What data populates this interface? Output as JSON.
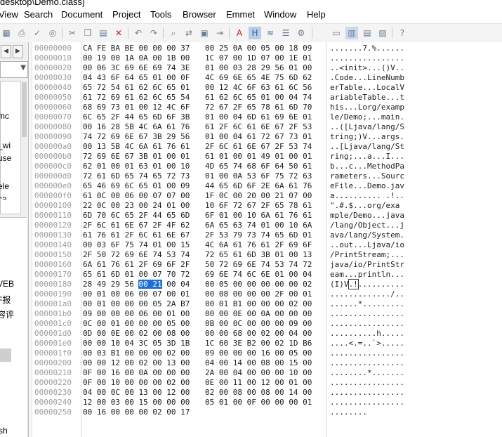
{
  "window": {
    "title_fragment": "desktop\\Demo.class]"
  },
  "menubar": {
    "items": [
      "View",
      "Search",
      "Document",
      "Project",
      "Tools",
      "Browser",
      "Emmet",
      "Window",
      "Help"
    ]
  },
  "toolbar": {
    "icons": [
      "grid-icon",
      "print-icon",
      "spellcheck-icon",
      "web-preview-icon",
      "cut-icon",
      "copy-icon",
      "paste-icon",
      "delete-icon",
      "undo-icon",
      "redo-icon",
      "find-icon",
      "replace-icon",
      "find-in-files-icon",
      "goto-icon",
      "font-icon",
      "hex-mode-icon",
      "word-wrap-icon",
      "line-numbers-icon",
      "settings-gear-icon",
      "layout-1-icon",
      "layout-2-icon",
      "layout-3-icon",
      "layout-4-icon",
      "help-icon"
    ]
  },
  "sidebar": {
    "nav_left": "◀",
    "nav_right": "▶",
    "combo_arrow": "▼",
    "list_fragments": [
      "mc",
      "_wi",
      "use",
      "ele",
      "ca"
    ],
    "panel_fragments": [
      "VEB",
      "F报",
      "容评",
      "sh"
    ]
  },
  "hex": {
    "rows": [
      {
        "addr": "00000000",
        "a": "CA FE BA BE 00 00 00 37",
        "b": "00 25 0A 00 05 00 18 09",
        "ascii": ".......7.%......"
      },
      {
        "addr": "00000010",
        "a": "00 19 00 1A 0A 00 1B 00",
        "b": "1C 07 00 1D 07 00 1E 01",
        "ascii": "................"
      },
      {
        "addr": "00000020",
        "a": "00 06 3C 69 6E 69 74 3E",
        "b": "01 00 03 28 29 56 01 00",
        "ascii": "..<init>...()V.."
      },
      {
        "addr": "00000030",
        "a": "04 43 6F 64 65 01 00 0F",
        "b": "4C 69 6E 65 4E 75 6D 62",
        "ascii": ".Code...LineNumb"
      },
      {
        "addr": "00000040",
        "a": "65 72 54 61 62 6C 65 01",
        "b": "00 12 4C 6F 63 61 6C 56",
        "ascii": "erTable...LocalV"
      },
      {
        "addr": "00000050",
        "a": "61 72 69 61 62 6C 65 54",
        "b": "61 62 6C 65 01 00 04 74",
        "ascii": "ariableTable...t"
      },
      {
        "addr": "00000060",
        "a": "68 69 73 01 00 12 4C 6F",
        "b": "72 67 2F 65 78 61 6D 70",
        "ascii": "his...Lorg/examp"
      },
      {
        "addr": "00000070",
        "a": "6C 65 2F 44 65 6D 6F 3B",
        "b": "01 00 04 6D 61 69 6E 01",
        "ascii": "le/Demo;...main."
      },
      {
        "addr": "00000080",
        "a": "00 16 28 5B 4C 6A 61 76",
        "b": "61 2F 6C 61 6E 67 2F 53",
        "ascii": "..([Ljava/lang/S"
      },
      {
        "addr": "00000090",
        "a": "74 72 69 6E 67 3B 29 56",
        "b": "01 00 04 61 72 67 73 01",
        "ascii": "tring;)V...args."
      },
      {
        "addr": "000000a0",
        "a": "00 13 5B 4C 6A 61 76 61",
        "b": "2F 6C 61 6E 67 2F 53 74",
        "ascii": "..[Ljava/lang/St"
      },
      {
        "addr": "000000b0",
        "a": "72 69 6E 67 3B 01 00 01",
        "b": "61 01 00 01 49 01 00 01",
        "ascii": "ring;...a...I..."
      },
      {
        "addr": "000000c0",
        "a": "62 01 00 01 63 01 00 10",
        "b": "4D 65 74 68 6F 64 50 61",
        "ascii": "b...c...MethodPa"
      },
      {
        "addr": "000000d0",
        "a": "72 61 6D 65 74 65 72 73",
        "b": "01 00 0A 53 6F 75 72 63",
        "ascii": "rameters...Sourc"
      },
      {
        "addr": "000000e0",
        "a": "65 46 69 6C 65 01 00 09",
        "b": "44 65 6D 6F 2E 6A 61 76",
        "ascii": "eFile...Demo.jav"
      },
      {
        "addr": "000000f0",
        "a": "61 0C 00 06 00 07 07 00",
        "b": "1F 0C 00 20 00 21 07 00",
        "ascii": "a.......... .!.."
      },
      {
        "addr": "00000100",
        "a": "22 0C 00 23 00 24 01 00",
        "b": "10 6F 72 67 2F 65 78 61",
        "ascii": "\".#.$...org/exa"
      },
      {
        "addr": "00000110",
        "a": "6D 70 6C 65 2F 44 65 6D",
        "b": "6F 01 00 10 6A 61 76 61",
        "ascii": "mple/Demo...java"
      },
      {
        "addr": "00000120",
        "a": "2F 6C 61 6E 67 2F 4F 62",
        "b": "6A 65 63 74 01 00 10 6A",
        "ascii": "/lang/Object...j"
      },
      {
        "addr": "00000130",
        "a": "61 76 61 2F 6C 61 6E 67",
        "b": "2F 53 79 73 74 65 6D 01",
        "ascii": "ava/lang/System."
      },
      {
        "addr": "00000140",
        "a": "00 03 6F 75 74 01 00 15",
        "b": "4C 6A 61 76 61 2F 69 6F",
        "ascii": "..out...Ljava/io"
      },
      {
        "addr": "00000150",
        "a": "2F 50 72 69 6E 74 53 74",
        "b": "72 65 61 6D 3B 01 00 13",
        "ascii": "/PrintStream;..."
      },
      {
        "addr": "00000160",
        "a": "6A 61 76 61 2F 69 6F 2F",
        "b": "50 72 69 6E 74 53 74 72",
        "ascii": "java/io/PrintStr"
      },
      {
        "addr": "00000170",
        "a": "65 61 6D 01 00 07 70 72",
        "b": "69 6E 74 6C 6E 01 00 04",
        "ascii": "eam...println..."
      },
      {
        "addr": "00000180",
        "a_pre": "28 49 29 56 ",
        "a_sel": "00 21",
        "a_post": " 00 04",
        "b": "00 05 00 00 00 00 00 02",
        "ascii_pre": "(I)V",
        "ascii_sel": ".!",
        "ascii_post": ".........."
      },
      {
        "addr": "00000190",
        "a": "00 01 00 06 00 07 00 01",
        "b": "00 08 00 00 00 2F 00 01",
        "ascii": "............./.."
      },
      {
        "addr": "000001a0",
        "a": "00 01 00 00 00 05 2A B7",
        "b": "00 01 B1 00 00 00 02 00",
        "ascii": "......*........."
      },
      {
        "addr": "000001b0",
        "a": "09 00 00 00 06 00 01 00",
        "b": "00 00 0E 00 0A 00 00 00",
        "ascii": "................"
      },
      {
        "addr": "000001c0",
        "a": "0C 00 01 00 00 00 05 00",
        "b": "0B 00 0C 00 00 00 09 00",
        "ascii": "................"
      },
      {
        "addr": "000001d0",
        "a": "0D 00 0E 00 02 00 08 00",
        "b": "00 00 68 00 02 00 04 00",
        "ascii": "..........h....."
      },
      {
        "addr": "000001e0",
        "a": "00 00 10 04 3C 05 3D 1B",
        "b": "1C 60 3E B2 00 02 1D B6",
        "ascii": "....<.=..`>....."
      },
      {
        "addr": "000001f0",
        "a": "00 03 B1 00 00 00 02 00",
        "b": "09 00 00 00 16 00 05 00",
        "ascii": "................"
      },
      {
        "addr": "00000200",
        "a": "00 00 12 00 02 00 13 00",
        "b": "04 00 14 00 08 00 15 00",
        "ascii": "................"
      },
      {
        "addr": "00000210",
        "a": "0F 00 16 00 0A 00 00 00",
        "b": "2A 00 04 00 00 00 10 00",
        "ascii": "........*......."
      },
      {
        "addr": "00000220",
        "a": "0F 00 10 00 00 00 02 00",
        "b": "0E 00 11 00 12 00 01 00",
        "ascii": "................"
      },
      {
        "addr": "00000230",
        "a": "04 00 0C 00 13 00 12 00",
        "b": "02 00 08 00 08 00 14 00",
        "ascii": "................"
      },
      {
        "addr": "00000240",
        "a": "12 00 03 00 15 00 00 00",
        "b": "05 01 00 0F 00 00 00 01",
        "ascii": "................"
      },
      {
        "addr": "00000250",
        "a": "00 16 00 00 00 02 00 17",
        "b": "",
        "ascii": "........"
      }
    ]
  },
  "colors": {
    "selection": "#1f6ed4",
    "address_text": "#9e9e9e",
    "toolbar_bg": "#f4f4f4",
    "sidebar_bg": "#f0f0f0"
  }
}
